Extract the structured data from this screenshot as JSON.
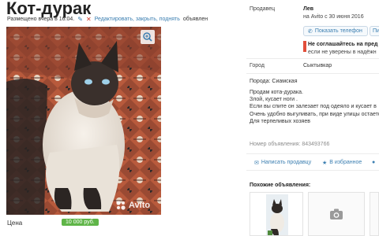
{
  "listing": {
    "title": "Кот-дурак",
    "posted": "Размещено вчера в 16:04.",
    "action_links": "Редактировать, закрыть, поднять",
    "action_suffix": "объявлен",
    "photo_watermark": "Avito",
    "price_label": "Цена",
    "price_value": "10 000 руб."
  },
  "seller": {
    "label": "Продавец",
    "name": "Лев",
    "since": "на Avito с 30 июня 2016",
    "show_phone_button": "Показать телефон",
    "next_button": "Пи",
    "warning_bold": "Не соглашайтесь на пред",
    "warning_text": "если не уверены в надёжн"
  },
  "location": {
    "label": "Город",
    "value": "Сыктывкар"
  },
  "details": {
    "breed": "Порода: Сиамская",
    "description": [
      "Продам кота-дурака.",
      "Злой, кусает ноги .",
      "Если вы спите он залезает под одеяло и кусает в",
      "Очень удобно выгуливать, при виде улицы остается",
      "Для терпеливых хозяев"
    ],
    "ad_number": "Номер объявления: 843493766"
  },
  "actions": {
    "write_seller": "Написать продавцу",
    "favorites": "В избранное"
  },
  "similar": {
    "title": "Похожие объявления:"
  },
  "colors": {
    "link": "#3c7fb1",
    "price": "#5fb548",
    "warning": "#e24f3b"
  },
  "icons": [
    "pencil-icon",
    "close-icon",
    "zoom-icon",
    "phone-icon",
    "message-icon",
    "star-icon",
    "camera-icon"
  ]
}
